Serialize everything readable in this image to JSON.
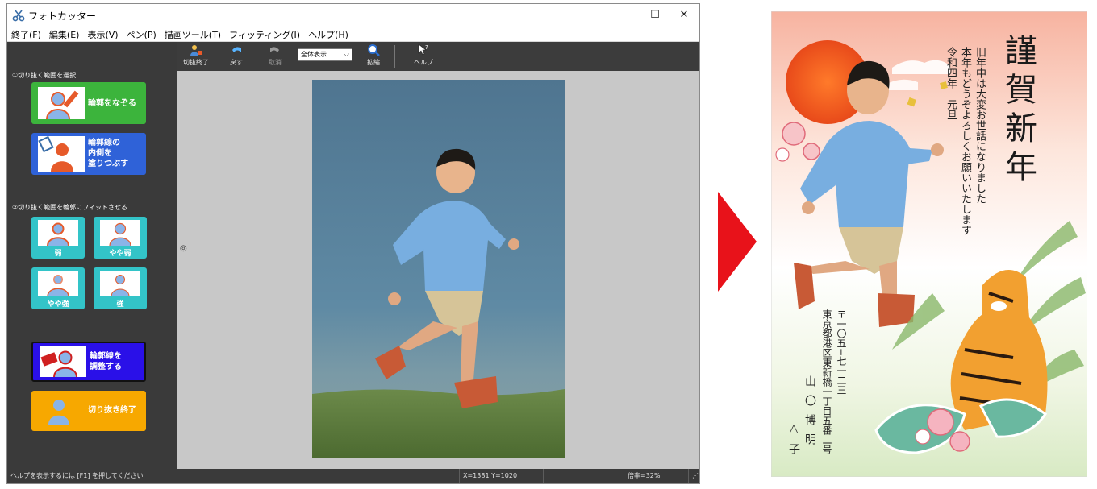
{
  "window": {
    "title": "フォトカッター",
    "buttons": {
      "minimize": "—",
      "maximize": "☐",
      "close": "✕"
    }
  },
  "menu": [
    "終了(F)",
    "編集(E)",
    "表示(V)",
    "ペン(P)",
    "描画ツール(T)",
    "フィッティング(I)",
    "ヘルプ(H)"
  ],
  "toolbar": {
    "finish_crop": "切抜終了",
    "undo": "戻す",
    "redo": "取消",
    "zoom_mode": "全体表示",
    "zoom_in": "拡縮",
    "help": "ヘルプ"
  },
  "left": {
    "section1": "①切り抜く範囲を選択",
    "trace_outline": "輪郭をなぞる",
    "fill_inside": "輪郭線の\n内側を\n塗りつぶす",
    "section2": "②切り抜く範囲を輪郭にフィットさせる",
    "fit_weak": "弱",
    "fit_slightly_weak": "やや弱",
    "fit_slightly_strong": "やや強",
    "fit_strong": "強",
    "adjust_outline": "輪郭線を\n調整する",
    "finish_crop": "切り抜き終了"
  },
  "status": {
    "help_hint": "ヘルプを表示するには [F1] を押してください",
    "coords": "X=1381 Y=1020",
    "zoom": "倍率=32%"
  },
  "card": {
    "greeting": [
      "謹",
      "賀",
      "新",
      "年"
    ],
    "message_lines": [
      "旧年中は大変お世話になりました",
      "本年もどうぞよろしくお願いいたします",
      "令和四年　元旦"
    ],
    "postal": "〒一〇五−七一二三",
    "address": "東京都港区東新橋一丁目五番二号",
    "name1": "山〇博明",
    "name2": "△子"
  },
  "colors": {
    "green_button": "#3cb43c",
    "blue_button": "#2f62d8",
    "teal_button": "#33c4c8",
    "violet_button": "#2a10e8",
    "orange_button": "#f7a800",
    "arrow": "#e8121a"
  }
}
